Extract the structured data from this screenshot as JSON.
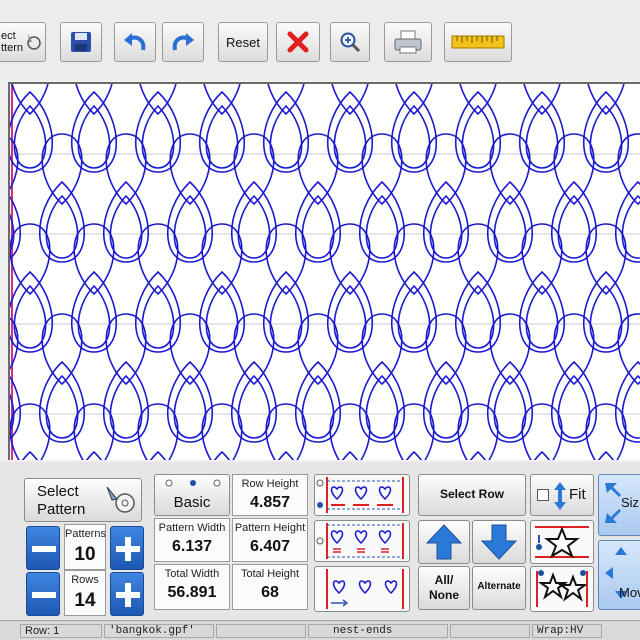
{
  "toolbar": {
    "select_pattern_label_part": "ect\nttern",
    "reset_label": "Reset",
    "icons": [
      "select-pattern-icon",
      "save-icon",
      "undo-icon",
      "redo-icon",
      "delete-icon",
      "zoom-in-icon",
      "print-icon",
      "ruler-icon"
    ]
  },
  "colors": {
    "pattern_stroke": "#1a1ad0",
    "accent_blue": "#2a6fd6",
    "delete_red": "#e02020"
  },
  "pattern": {
    "name": "bangkok.gpf",
    "rows_count": 14,
    "patterns_count": 10
  },
  "panel": {
    "select_pattern": {
      "line1": "Select",
      "line2": "Pattern"
    },
    "patterns": {
      "label": "Patterns",
      "value": "10"
    },
    "rows": {
      "label": "Rows",
      "value": "14"
    },
    "basic": {
      "label": "Basic"
    },
    "row_height": {
      "label": "Row Height",
      "value": "4.857"
    },
    "pattern_width": {
      "label": "Pattern Width",
      "value": "6.137"
    },
    "pattern_height": {
      "label": "Pattern Height",
      "value": "6.407"
    },
    "total_width": {
      "label": "Total Width",
      "value": "56.891"
    },
    "total_height": {
      "label": "Total Height",
      "value": "68"
    },
    "select_row": "Select Row",
    "all_none": {
      "line1": "All/",
      "line2": "None"
    },
    "alternate": "Alternate",
    "fit": "Fit",
    "size": "Siz",
    "move": "Mov"
  },
  "status": {
    "row": "Row: 1",
    "file": "'bangkok.gpf'",
    "blank": "",
    "mode": "nest-ends",
    "wrap": "Wrap:HV"
  }
}
